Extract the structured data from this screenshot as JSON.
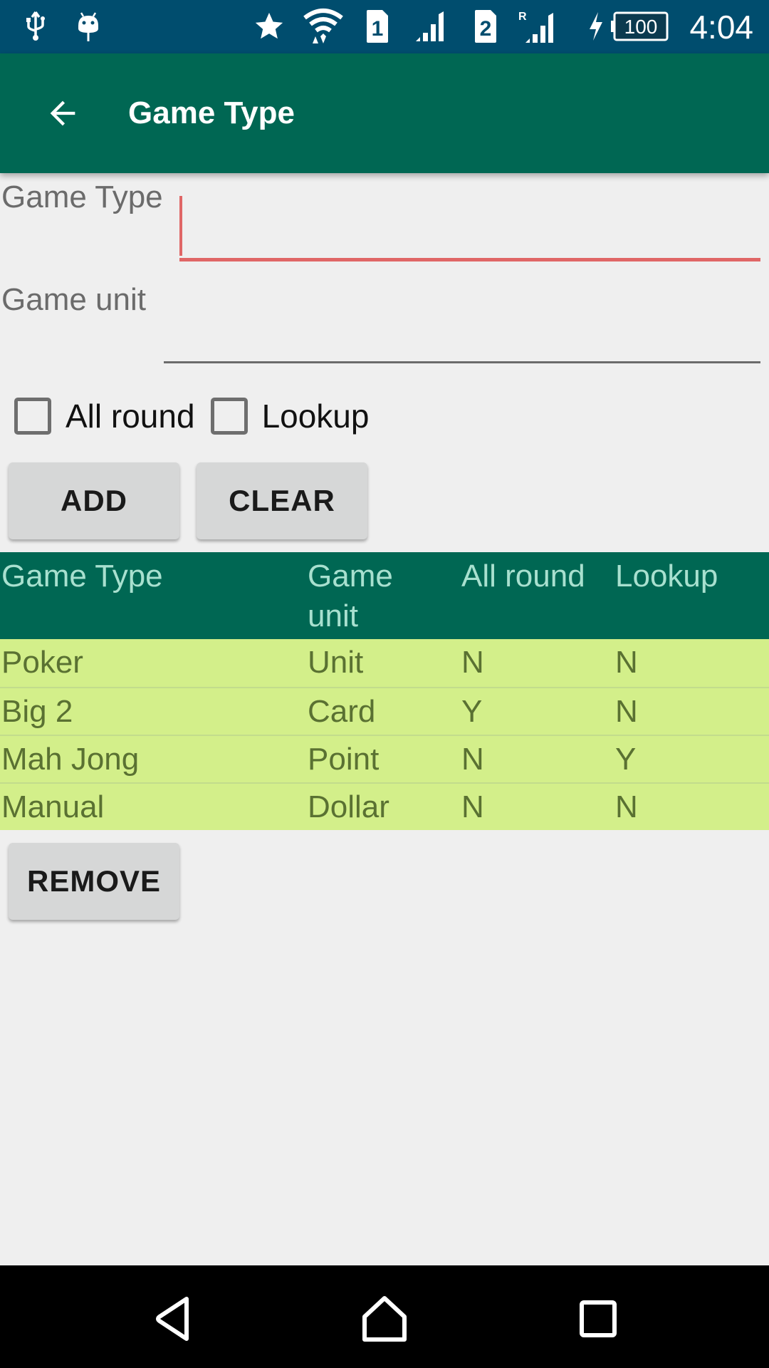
{
  "status_bar": {
    "icons": [
      "usb-icon",
      "android-debug-icon",
      "star-icon",
      "wifi-icon",
      "sim-1-icon",
      "signal-1-icon",
      "sim-2-icon",
      "roaming-signal-2-icon",
      "charging-icon",
      "battery-icon"
    ],
    "sim1_label": "1",
    "sim2_label": "2",
    "roaming_label": "R",
    "battery_level": "100",
    "time": "4:04",
    "background_color": "#004d6e"
  },
  "app_bar": {
    "title": "Game Type",
    "back_icon": "arrow-back-icon",
    "background_color": "#006753"
  },
  "form": {
    "game_type": {
      "label": "Game Type",
      "value": "",
      "placeholder": ""
    },
    "game_unit": {
      "label": "Game unit",
      "value": "",
      "placeholder": ""
    },
    "checkboxes": [
      {
        "label": "All round",
        "checked": false
      },
      {
        "label": "Lookup",
        "checked": false
      }
    ],
    "add_label": "ADD",
    "clear_label": "CLEAR",
    "error_color": "#e06666"
  },
  "table": {
    "headers": [
      "Game Type",
      "Game unit",
      "All round",
      "Lookup"
    ],
    "rows": [
      [
        "Poker",
        "Unit",
        "N",
        "N"
      ],
      [
        "Big 2",
        "Card",
        "Y",
        "N"
      ],
      [
        "Mah Jong",
        "Point",
        "N",
        "Y"
      ],
      [
        "Manual",
        "Dollar",
        "N",
        "N"
      ]
    ],
    "header_color": "#006753",
    "row_color": "#d3ef8a"
  },
  "remove_label": "REMOVE",
  "nav_bar": {
    "buttons": [
      "back-icon",
      "home-icon",
      "recents-icon"
    ]
  }
}
